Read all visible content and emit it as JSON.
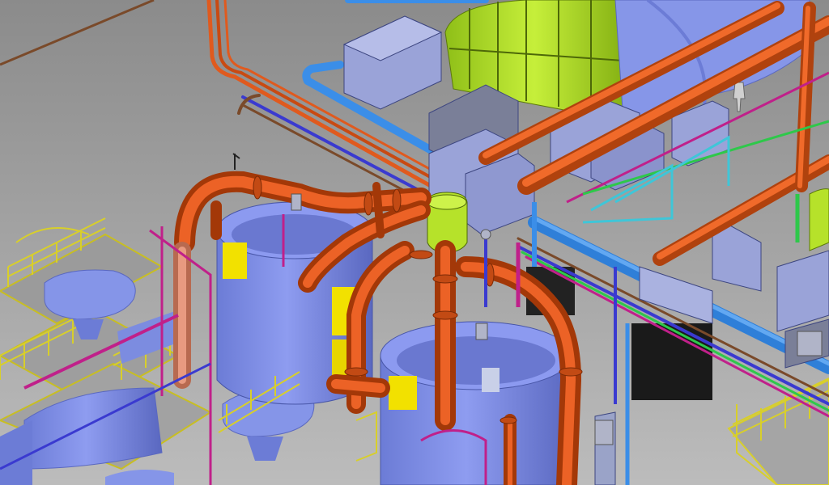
{
  "scene": {
    "type": "3d-plant-piping-model",
    "watermark": "",
    "colors": {
      "background_top": "#8a8a8a",
      "background_bottom": "#bdbdbd",
      "vessel": "#7f8fe6",
      "vessel_shadow": "#5f6fc8",
      "pipe_orange": "#e05a1e",
      "pipe_orange_dark": "#a83a0c",
      "pipe_blue": "#3b8ee8",
      "pipe_magenta": "#c0208a",
      "pipe_green": "#2ec84a",
      "pipe_cyan": "#3fc6d8",
      "railing_yellow": "#d8cf2a",
      "turbine_green": "#b6e22a",
      "equipment_gray": "#9aa3c8",
      "dark_block": "#1a1a1a",
      "yellow_block": "#f2e100"
    },
    "icons": [
      "worker-figure-icon"
    ]
  }
}
